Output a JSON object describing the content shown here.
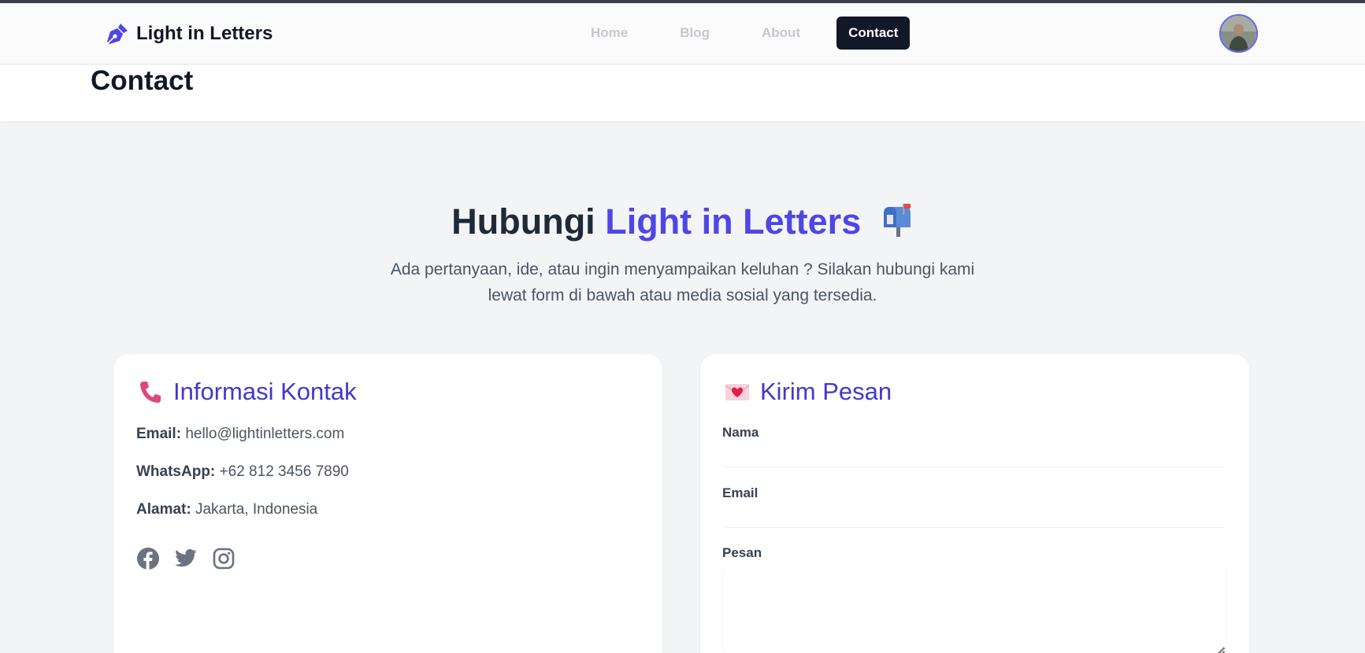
{
  "brand": {
    "name": "Light in Letters",
    "icon": "pen-nib-icon"
  },
  "nav": {
    "items": [
      {
        "label": "Home",
        "active": false
      },
      {
        "label": "Blog",
        "active": false
      },
      {
        "label": "About",
        "active": false
      },
      {
        "label": "Contact",
        "active": true
      }
    ]
  },
  "page": {
    "title": "Contact"
  },
  "hero": {
    "title_prefix": "Hubungi",
    "title_accent": "Light in Letters",
    "title_icon": "mailbox-icon",
    "subtitle": "Ada pertanyaan, ide, atau ingin menyampaikan keluhan ? Silakan hubungi kami lewat form di bawah atau media sosial yang tersedia."
  },
  "contact_info": {
    "title": "Informasi Kontak",
    "icon": "phone-icon",
    "email_label": "Email:",
    "email_value": "hello@lightinletters.com",
    "whatsapp_label": "WhatsApp:",
    "whatsapp_value": "+62 812 3456 7890",
    "address_label": "Alamat:",
    "address_value": "Jakarta, Indonesia",
    "social": [
      "facebook-icon",
      "twitter-icon",
      "instagram-icon"
    ]
  },
  "form": {
    "title": "Kirim Pesan",
    "icon": "love-letter-icon",
    "name_label": "Nama",
    "name_value": "",
    "email_label": "Email",
    "email_value": "",
    "message_label": "Pesan",
    "message_value": ""
  },
  "colors": {
    "accent": "#4f46e5",
    "accent_dark": "#4338ca",
    "nav_active_bg": "#111827",
    "background": "#f3f4f6"
  }
}
